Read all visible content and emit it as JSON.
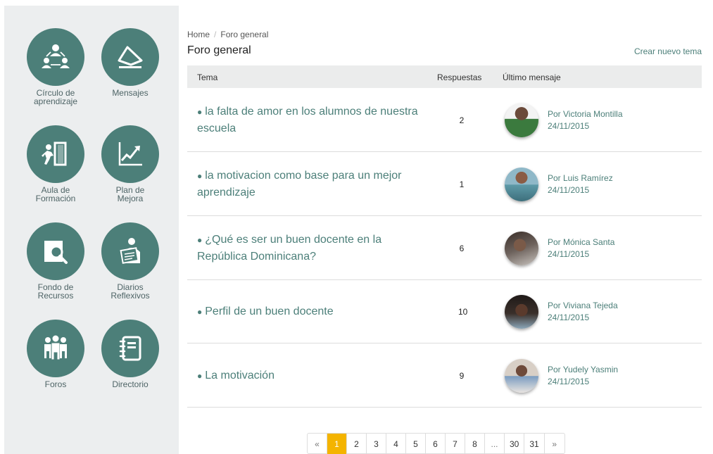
{
  "sidebar": {
    "items": [
      {
        "label": "Círculo de\naprendizaje",
        "icon": "learning-circle-icon"
      },
      {
        "label": "Mensajes",
        "icon": "envelope-icon"
      },
      {
        "label": "Aula de\nFormación",
        "icon": "classroom-door-icon"
      },
      {
        "label": "Plan de\nMejora",
        "icon": "growth-chart-icon"
      },
      {
        "label": "Fondo de\nRecursos",
        "icon": "resource-search-icon"
      },
      {
        "label": "Diarios\nReflexivos",
        "icon": "newspaper-reader-icon"
      },
      {
        "label": "Foros",
        "icon": "group-people-icon"
      },
      {
        "label": "Directorio",
        "icon": "address-book-icon"
      }
    ],
    "accent": "#4c7f79"
  },
  "breadcrumb": {
    "home": "Home",
    "separator": "/",
    "current": "Foro general"
  },
  "page": {
    "title": "Foro general",
    "new_topic": "Crear nuevo tema"
  },
  "table": {
    "headers": {
      "tema": "Tema",
      "respuestas": "Respuestas",
      "ultimo": "Último mensaje"
    },
    "rows": [
      {
        "topic": "la falta de amor en los alumnos de nuestra escuela",
        "count": "2",
        "author": "Por Victoria Montilla",
        "date": "24/11/2015"
      },
      {
        "topic": "la motivacion como base para un mejor aprendizaje",
        "count": "1",
        "author": "Por Luis Ramírez",
        "date": "24/11/2015"
      },
      {
        "topic": "¿Qué es ser un buen docente en la República Dominicana?",
        "count": "6",
        "author": "Por Mónica Santa",
        "date": "24/11/2015"
      },
      {
        "topic": "Perfil de un buen docente",
        "count": "10",
        "author": "Por Viviana Tejeda",
        "date": "24/11/2015"
      },
      {
        "topic": "La motivación",
        "count": "9",
        "author": "Por Yudely Yasmin",
        "date": "24/11/2015"
      }
    ]
  },
  "pagination": {
    "pages": [
      "«",
      "1",
      "2",
      "3",
      "4",
      "5",
      "6",
      "7",
      "8",
      "...",
      "30",
      "31",
      "»"
    ],
    "active": "1",
    "active_color": "#f4b400"
  }
}
